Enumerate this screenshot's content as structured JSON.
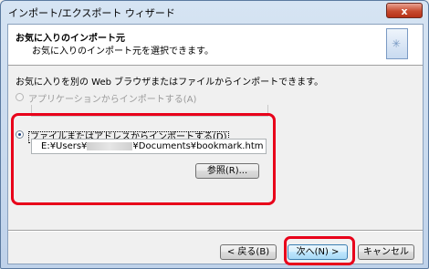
{
  "window": {
    "title": "インポート/エクスポート ウィザード",
    "close_label": "x"
  },
  "header": {
    "title": "お気に入りのインポート元",
    "subtitle": "お気に入りのインポート元を選択できます。",
    "icon": "wizard-star-icon"
  },
  "body": {
    "description": "お気に入りを別の Web ブラウザまたはファイルからインポートできます。",
    "option_app": {
      "label": "アプリケーションからインポートする(A)",
      "selected": false,
      "enabled": false
    },
    "option_file": {
      "label": "ファイルまたはアドレスからインポートする(D)",
      "selected": true,
      "enabled": true
    },
    "path_prefix": "E:¥Users¥",
    "path_suffix": "¥Documents¥bookmark.htm",
    "browse_label": "参照(R)..."
  },
  "footer": {
    "back_label": "< 戻る(B)",
    "next_label": "次へ(N) >",
    "cancel_label": "キャンセル"
  },
  "highlight_color": "#e8001a"
}
